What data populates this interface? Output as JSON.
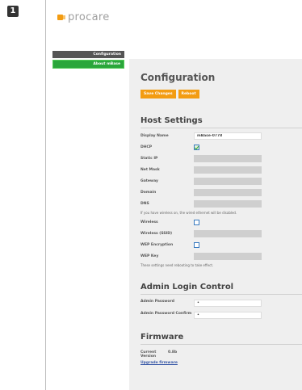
{
  "step": "1",
  "brand": {
    "name": "procare"
  },
  "sidebar": {
    "items": [
      {
        "label": "Configuration"
      },
      {
        "label": "About mBase"
      }
    ]
  },
  "main": {
    "title": "Configuration",
    "buttons": {
      "save": "Save Changes",
      "reboot": "Reboot"
    },
    "host_settings": {
      "title": "Host Settings",
      "display_name_label": "Display Name",
      "display_name_value": "mBase-0778",
      "dhcp_label": "DHCP",
      "dhcp_checked": true,
      "static_ip_label": "Static IP",
      "net_mask_label": "Net Mask",
      "gateway_label": "Gateway",
      "domain_label": "Domain",
      "dns_label": "DNS",
      "wireless_note": "If you have wireless on, the wired ethernet will be disabled.",
      "wireless_label": "Wireless",
      "wireless_checked": false,
      "ssid_label": "Wireless (SSID)",
      "wep_label": "WEP Encryption",
      "wep_checked": false,
      "wep_key_label": "WEP Key",
      "settings_note": "These settings need rebooting to take effect."
    },
    "admin": {
      "title": "Admin Login Control",
      "password_label": "Admin Password",
      "password_value": "•",
      "confirm_label": "Admin Password Confirm",
      "confirm_value": "•"
    },
    "firmware": {
      "title": "Firmware",
      "current_label": "Current Version",
      "current_value": "0.8b",
      "upgrade_link": "Upgrade firmware"
    }
  },
  "colors": {
    "accent": "#f39c12",
    "sidebar_active": "#2aa63a",
    "sidebar_dark": "#555555",
    "panel_bg": "#efefef",
    "field_disabled": "#cfcfcf"
  }
}
